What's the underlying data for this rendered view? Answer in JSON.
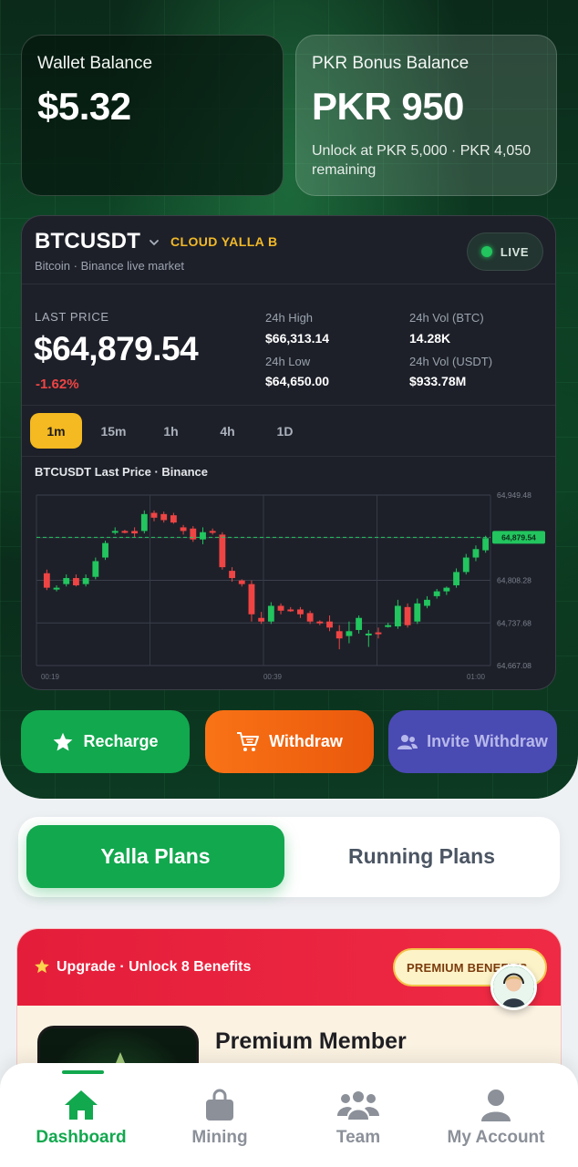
{
  "wallet": {
    "label": "Wallet Balance",
    "value": "$5.32"
  },
  "bonus": {
    "label": "PKR Bonus Balance",
    "value": "PKR 950",
    "note": "Unlock at PKR 5,000 · PKR 4,050 remaining"
  },
  "market": {
    "pair": "BTCUSDT",
    "brand": "CLOUD YALLA B",
    "subtitle": "Bitcoin · Binance live market",
    "live": "LIVE",
    "last_price_label": "LAST PRICE",
    "last_price": "$64,879.54",
    "change": "-1.62%",
    "stats": {
      "high_label": "24h High",
      "high": "$66,313.14",
      "low_label": "24h Low",
      "low": "$64,650.00",
      "vol_btc_label": "24h Vol (BTC)",
      "vol_btc": "14.28K",
      "vol_usdt_label": "24h Vol (USDT)",
      "vol_usdt": "$933.78M"
    },
    "timeframes": [
      "1m",
      "15m",
      "1h",
      "4h",
      "1D"
    ],
    "active_timeframe": "1m",
    "chart_title": "BTCUSDT Last Price · Binance"
  },
  "chart_data": {
    "type": "candlestick",
    "title": "BTCUSDT Last Price · Binance",
    "y_ticks": [
      "64,949.48",
      "64,878.88",
      "64,808.28",
      "64,737.68",
      "64,667.08"
    ],
    "x_ticks": [
      "00:19",
      "00:39",
      "01:00"
    ],
    "current_price_label": "64,879.54",
    "current_price": 64879.54,
    "ylim": [
      64667.08,
      64949.48
    ],
    "up_color": "#22c55e",
    "down_color": "#ef4444",
    "candles": [
      [
        64820,
        64826,
        64792,
        64796
      ],
      [
        64794,
        64800,
        64790,
        64796
      ],
      [
        64802,
        64818,
        64798,
        64812
      ],
      [
        64812,
        64818,
        64798,
        64800
      ],
      [
        64802,
        64818,
        64798,
        64812
      ],
      [
        64814,
        64846,
        64810,
        64840
      ],
      [
        64846,
        64874,
        64842,
        64870
      ],
      [
        64888,
        64896,
        64884,
        64890
      ],
      [
        64890,
        64892,
        64886,
        64888
      ],
      [
        64890,
        64896,
        64880,
        64886
      ],
      [
        64890,
        64924,
        64886,
        64918
      ],
      [
        64920,
        64924,
        64906,
        64912
      ],
      [
        64918,
        64922,
        64904,
        64908
      ],
      [
        64916,
        64920,
        64902,
        64904
      ],
      [
        64896,
        64900,
        64884,
        64890
      ],
      [
        64894,
        64898,
        64872,
        64876
      ],
      [
        64876,
        64896,
        64868,
        64888
      ],
      [
        64890,
        64894,
        64884,
        64888
      ],
      [
        64884,
        64888,
        64826,
        64830
      ],
      [
        64824,
        64830,
        64806,
        64812
      ],
      [
        64808,
        64810,
        64798,
        64802
      ],
      [
        64802,
        64808,
        64740,
        64752
      ],
      [
        64746,
        64756,
        64736,
        64740
      ],
      [
        64740,
        64772,
        64736,
        64766
      ],
      [
        64766,
        64770,
        64752,
        64758
      ],
      [
        64760,
        64764,
        64756,
        64758
      ],
      [
        64760,
        64764,
        64746,
        64752
      ],
      [
        64754,
        64758,
        64736,
        64740
      ],
      [
        64740,
        64742,
        64734,
        64738
      ],
      [
        64740,
        64750,
        64724,
        64730
      ],
      [
        64724,
        64734,
        64694,
        64712
      ],
      [
        64716,
        64740,
        64704,
        64724
      ],
      [
        64726,
        64750,
        64720,
        64746
      ],
      [
        64720,
        64726,
        64698,
        64720
      ],
      [
        64722,
        64730,
        64712,
        64720
      ],
      [
        64734,
        64738,
        64730,
        64734
      ],
      [
        64732,
        64776,
        64728,
        64766
      ],
      [
        64764,
        64770,
        64730,
        64734
      ],
      [
        64740,
        64778,
        64736,
        64770
      ],
      [
        64766,
        64782,
        64762,
        64776
      ],
      [
        64782,
        64794,
        64778,
        64790
      ],
      [
        64790,
        64798,
        64784,
        64796
      ],
      [
        64800,
        64828,
        64796,
        64822
      ],
      [
        64822,
        64852,
        64818,
        64846
      ],
      [
        64846,
        64866,
        64840,
        64860
      ],
      [
        64858,
        64882,
        64854,
        64878
      ]
    ]
  },
  "actions": {
    "recharge": "Recharge",
    "withdraw": "Withdraw",
    "invite": "Invite Withdraw"
  },
  "plans": {
    "active": "Yalla Plans",
    "inactive": "Running Plans"
  },
  "premium": {
    "top_title": "Upgrade · Unlock 8 Benefits",
    "badge": "PREMIUM BENEFITS",
    "body_title": "Premium Member"
  },
  "nav": {
    "dashboard": "Dashboard",
    "mining": "Mining",
    "team": "Team",
    "account": "My Account"
  }
}
